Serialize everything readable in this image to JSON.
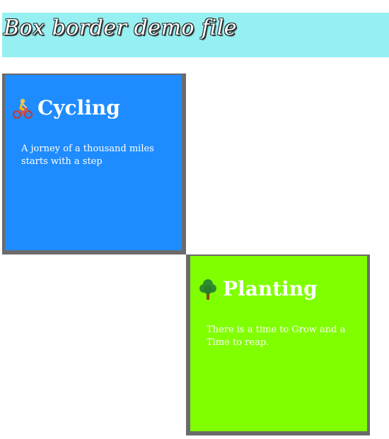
{
  "header": {
    "title": "Box border demo file"
  },
  "cards": [
    {
      "title": "Cycling",
      "icon": "bicycle-icon",
      "text": "A jorney of a thousand miles starts with a step",
      "background": "#1e8cff",
      "border": "#6b6b6b"
    },
    {
      "title": "Planting",
      "icon": "tree-icon",
      "text": "There is a time to Grow and a Time to reap.",
      "background": "#80ff00",
      "border": "#6b6b6b"
    }
  ]
}
